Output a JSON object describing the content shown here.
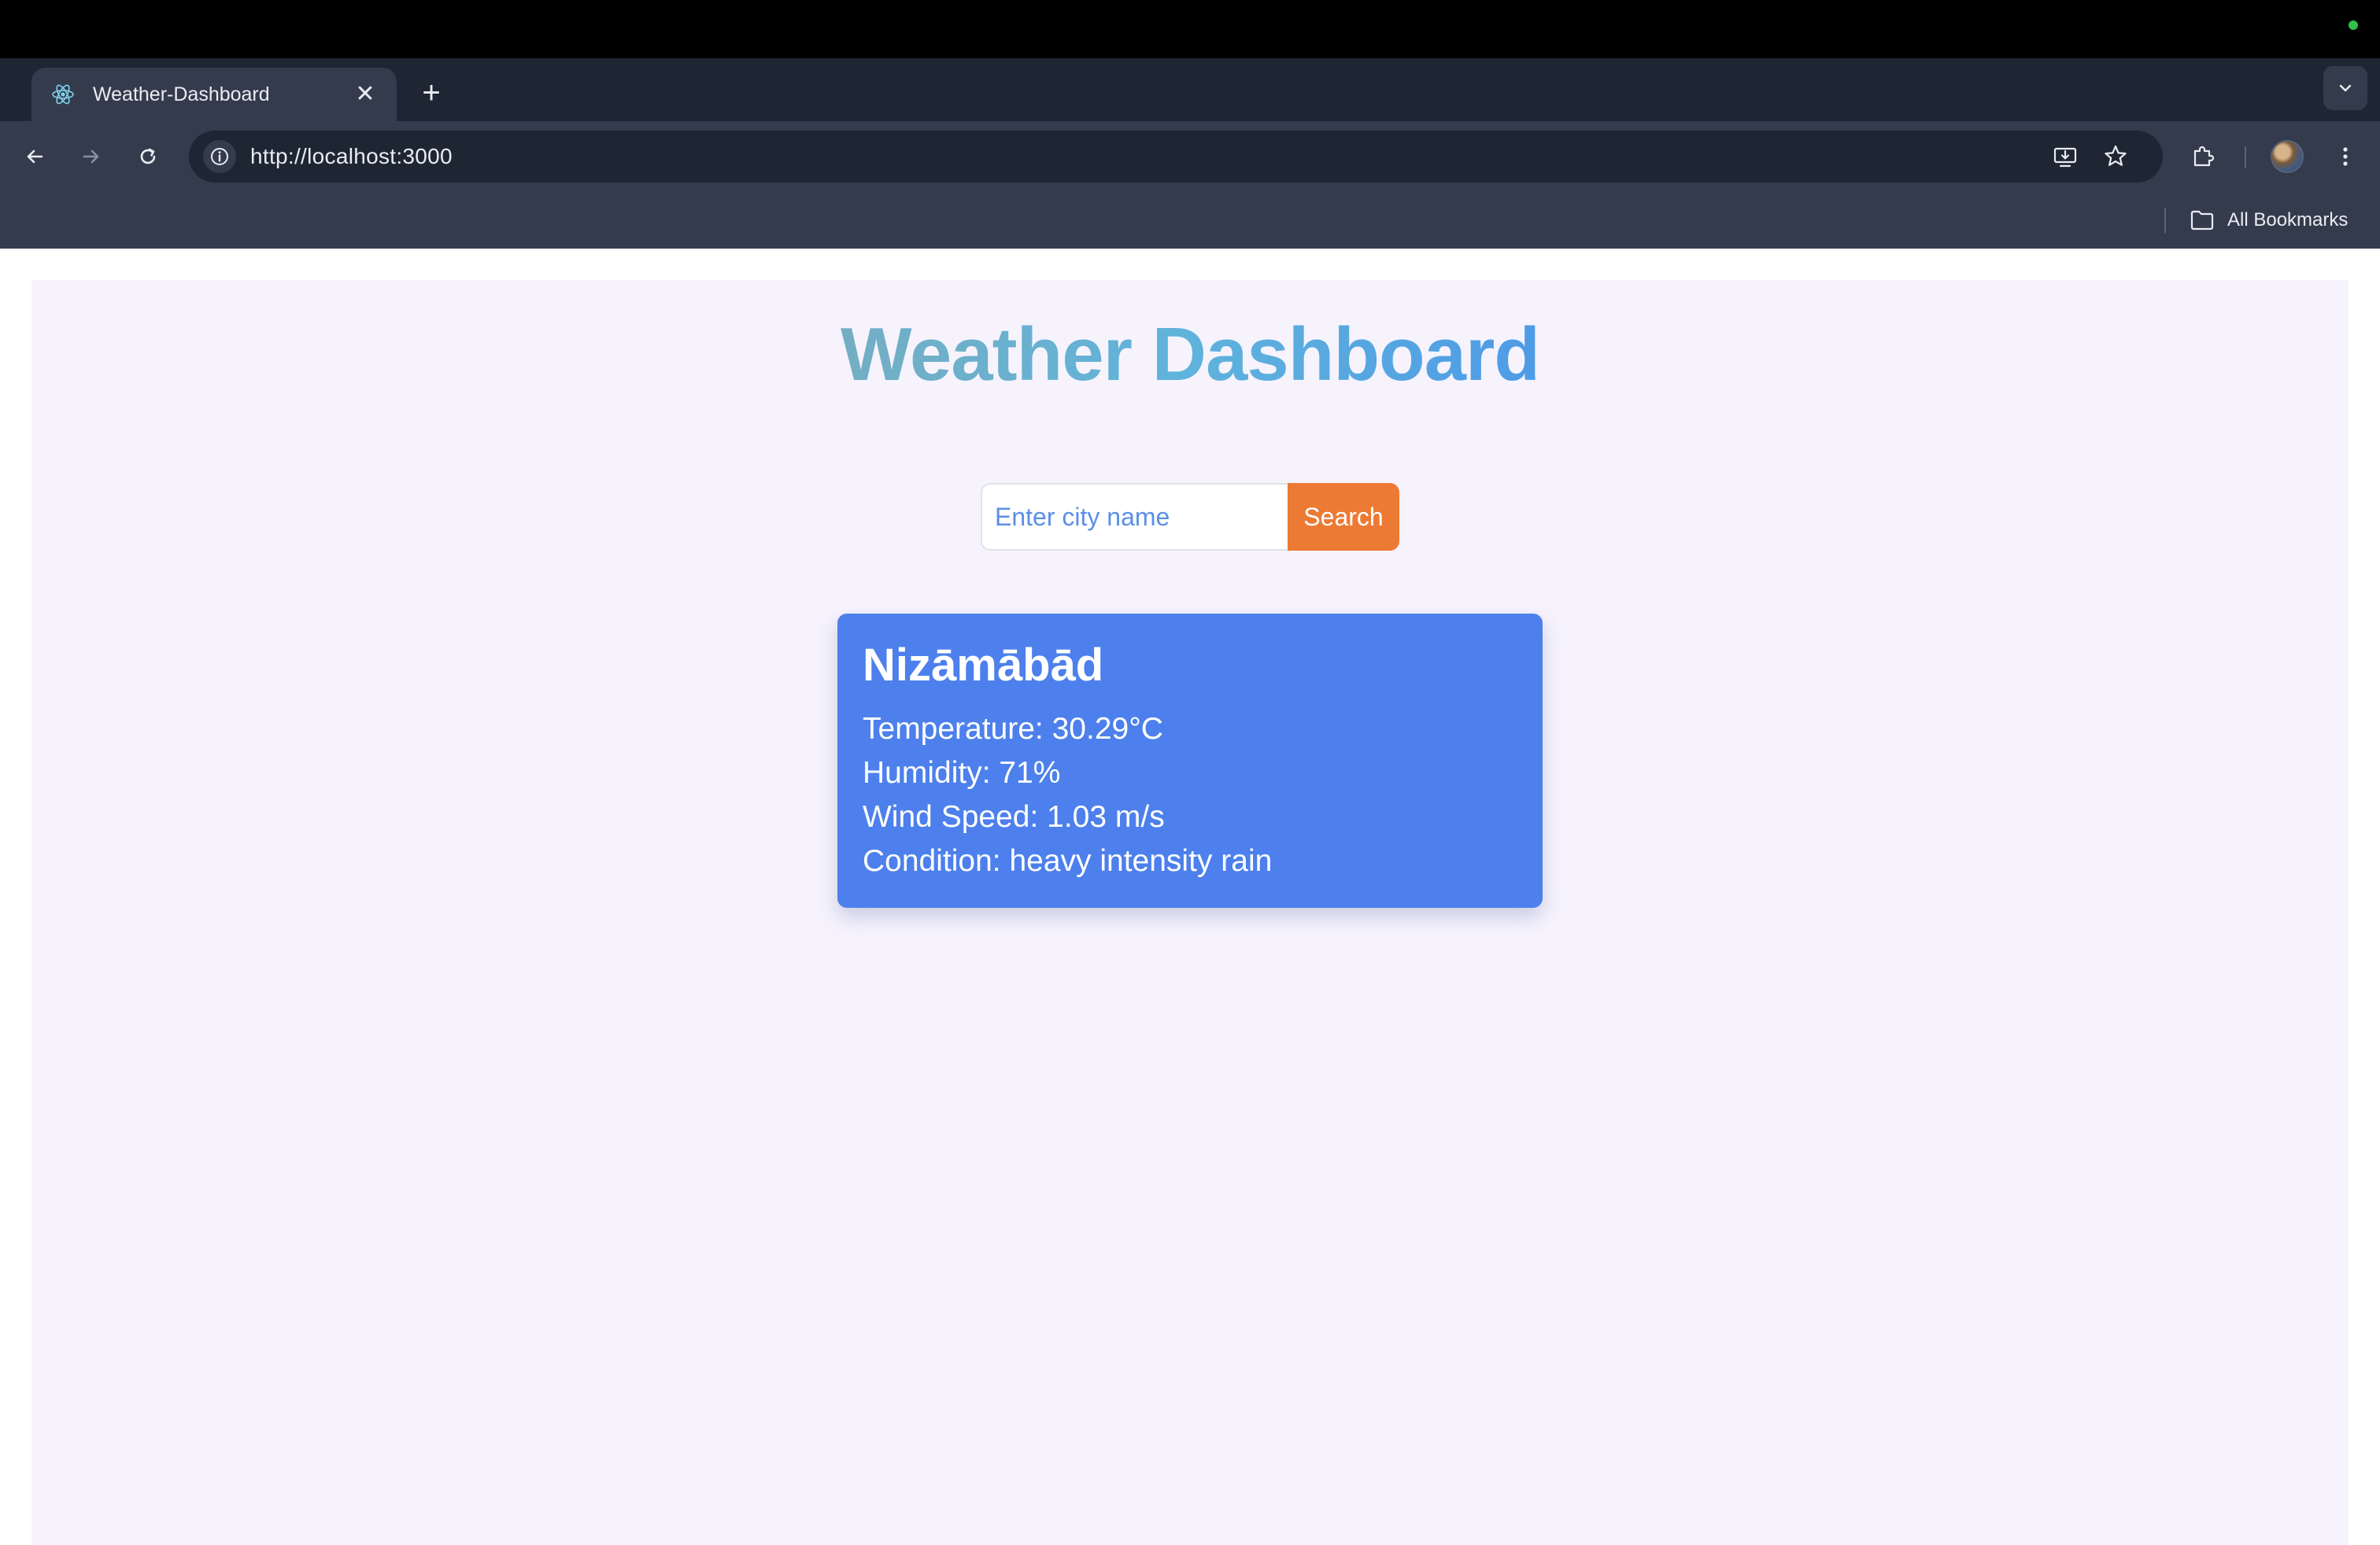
{
  "browser": {
    "tab": {
      "title": "Weather-Dashboard",
      "favicon": "react-icon",
      "close_icon": "close-icon"
    },
    "new_tab_icon": "plus-icon",
    "tab_search_icon": "chevron-down-icon",
    "toolbar": {
      "back_icon": "arrow-left-icon",
      "forward_icon": "arrow-right-icon",
      "reload_icon": "reload-icon",
      "site_info_icon": "info-icon",
      "url": "http://localhost:3000",
      "install_icon": "install-app-icon",
      "bookmark_icon": "star-icon",
      "extensions_icon": "puzzle-icon",
      "profile_icon": "avatar",
      "menu_icon": "kebab-menu-icon"
    },
    "bookmarks_bar": {
      "all_bookmarks_label": "All Bookmarks",
      "folder_icon": "folder-icon"
    }
  },
  "app": {
    "title": "Weather Dashboard",
    "title_gradient": [
      "#74aec3",
      "#4e9be6"
    ],
    "background_color": "#f6f3fd",
    "search": {
      "placeholder": "Enter city name",
      "value": "",
      "button_label": "Search",
      "button_color": "#ec7a34"
    },
    "weather": {
      "card_color": "#4d80ec",
      "city": "Nizāmābād",
      "temperature_line": "Temperature: 30.29°C",
      "humidity_line": "Humidity: 71%",
      "wind_line": "Wind Speed: 1.03 m/s",
      "condition_line": "Condition: heavy intensity rain"
    }
  }
}
